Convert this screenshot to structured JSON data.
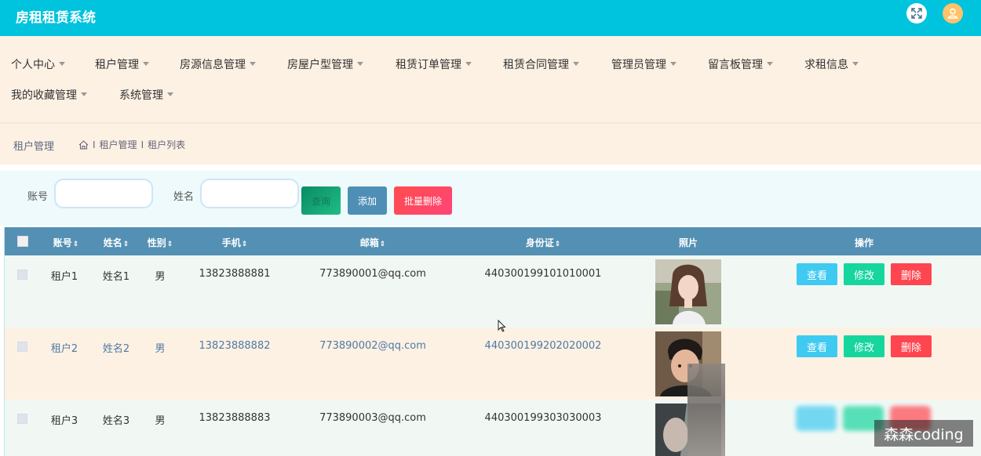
{
  "app": {
    "title": "房租租赁系统"
  },
  "nav": {
    "items": [
      {
        "label": "个人中心"
      },
      {
        "label": "租户管理"
      },
      {
        "label": "房源信息管理"
      },
      {
        "label": "房屋户型管理"
      },
      {
        "label": "租赁订单管理"
      },
      {
        "label": "租赁合同管理"
      },
      {
        "label": "管理员管理"
      },
      {
        "label": "留言板管理"
      },
      {
        "label": "求租信息"
      },
      {
        "label": "我的收藏管理"
      },
      {
        "label": "系统管理"
      }
    ]
  },
  "breadcrumb": {
    "title": "租户管理",
    "path": [
      "租户管理",
      "租户列表"
    ],
    "separator": "I"
  },
  "search": {
    "account_label": "账号",
    "account_value": "",
    "name_label": "姓名",
    "name_value": "",
    "query_label": "查询",
    "add_label": "添加",
    "batch_delete_label": "批量删除"
  },
  "table": {
    "columns": [
      "账号",
      "姓名",
      "性别",
      "手机",
      "邮箱",
      "身份证",
      "照片",
      "操作"
    ],
    "sort_icon": "⇕",
    "rows": [
      {
        "account": "租户1",
        "name": "姓名1",
        "gender": "男",
        "phone": "13823888881",
        "email": "773890001@qq.com",
        "id_card": "440300199101010001",
        "photo": "woman-portrait"
      },
      {
        "account": "租户2",
        "name": "姓名2",
        "gender": "男",
        "phone": "13823888882",
        "email": "773890002@qq.com",
        "id_card": "440300199202020002",
        "photo": "man-portrait"
      },
      {
        "account": "租户3",
        "name": "姓名3",
        "gender": "男",
        "phone": "13823888883",
        "email": "773890003@qq.com",
        "id_card": "440300199303030003",
        "photo": "portrait"
      }
    ],
    "actions": {
      "view": "查看",
      "edit": "修改",
      "delete": "删除"
    }
  },
  "watermark": {
    "text": "森森coding"
  },
  "colors": {
    "topbar": "#00c3de",
    "nav_bg": "#fdf1e4",
    "table_header": "#5490b3",
    "view": "#3fcaf2",
    "edit": "#16d69e",
    "delete": "#ff4550"
  }
}
